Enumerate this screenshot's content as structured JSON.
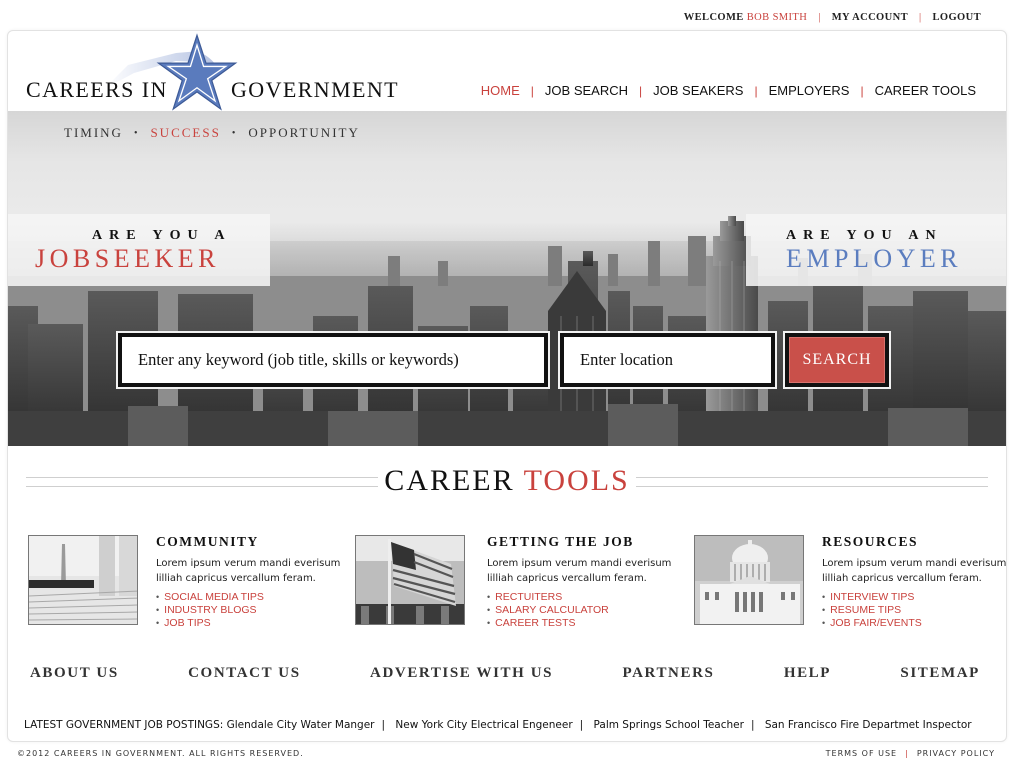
{
  "colors": {
    "accent_red": "#c9423d",
    "accent_blue": "#5b7dbf",
    "text_dark": "#111111"
  },
  "topbar": {
    "welcome_label": "WELCOME",
    "user_name": "BOB SMITH",
    "my_account": "MY ACCOUNT",
    "logout": "LOGOUT"
  },
  "logo": {
    "left_text": "CAREERS IN",
    "right_text": "GOVERNMENT",
    "icon": "star-icon"
  },
  "nav": {
    "items": [
      {
        "label": "HOME",
        "active": true
      },
      {
        "label": "JOB SEARCH"
      },
      {
        "label": "JOB SEAKERS"
      },
      {
        "label": "EMPLOYERS"
      },
      {
        "label": "CAREER TOOLS"
      }
    ]
  },
  "hero": {
    "tagline": [
      "TIMING",
      "SUCCESS",
      "OPPORTUNITY"
    ],
    "tagline_separator": "•",
    "jobseeker": {
      "question": "ARE YOU A",
      "answer": "JOBSEEKER"
    },
    "employer": {
      "question": "ARE YOU AN",
      "answer": "EMPLOYER"
    },
    "search": {
      "keyword_placeholder": "Enter any keyword (job title, skills or keywords)",
      "keyword_value": "",
      "location_placeholder": "Enter location",
      "location_value": "",
      "button_label": "SEARCH"
    }
  },
  "career_tools": {
    "title_dark": "CAREER",
    "title_red": "TOOLS",
    "columns": [
      {
        "title": "COMMUNITY",
        "image": "washington-monument-steps-photo",
        "description": "Lorem ipsum verum mandi everisum lilliah capricus vercallum feram.",
        "links": [
          "SOCIAL MEDIA TIPS",
          "INDUSTRY BLOGS",
          "JOB TIPS"
        ]
      },
      {
        "title": "GETTING THE JOB",
        "image": "american-flag-building-photo",
        "description": "Lorem ipsum verum mandi everisum lilliah capricus vercallum feram.",
        "links": [
          "RECTUITERS",
          "SALARY CALCULATOR",
          "CAREER TESTS"
        ]
      },
      {
        "title": "RESOURCES",
        "image": "capitol-building-photo",
        "description": "Lorem ipsum verum mandi everisum lilliah capricus vercallum feram.",
        "links": [
          "INTERVIEW TIPS",
          "RESUME TIPS",
          "JOB FAIR/EVENTS"
        ]
      }
    ]
  },
  "footer_nav": [
    "ABOUT US",
    "CONTACT US",
    "ADVERTISE WITH US",
    "PARTNERS",
    "HELP",
    "SITEMAP"
  ],
  "latest_postings": {
    "label": "LATEST GOVERNMENT JOB POSTINGS:",
    "items": [
      "Glendale City Water Manger",
      "New York City Electrical Engeneer",
      "Palm Springs School Teacher",
      "San Francisco Fire Departmet Inspector"
    ]
  },
  "copyright": "©2012 CAREERS IN GOVERNMENT. ALL RIGHTS RESERVED.",
  "legal": {
    "terms": "TERMS OF USE",
    "privacy": "PRIVACY POLICY"
  }
}
